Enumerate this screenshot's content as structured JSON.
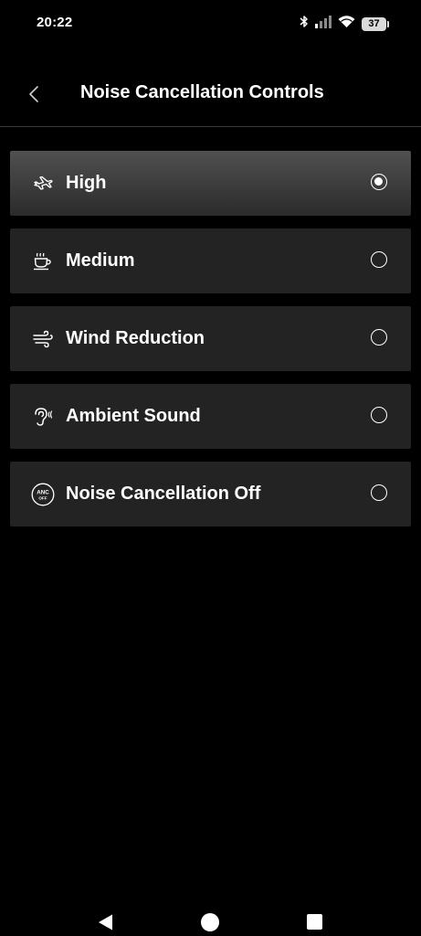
{
  "status_bar": {
    "time": "20:22",
    "battery_level": "37",
    "icons": [
      "bluetooth-icon",
      "signal-icon",
      "wifi-icon",
      "battery-icon"
    ]
  },
  "header": {
    "title": "Noise Cancellation Controls",
    "back_icon": "chevron-left-icon"
  },
  "options": [
    {
      "label": "High",
      "icon": "airplane-icon",
      "selected": true
    },
    {
      "label": "Medium",
      "icon": "coffee-cup-icon",
      "selected": false
    },
    {
      "label": "Wind Reduction",
      "icon": "wind-icon",
      "selected": false
    },
    {
      "label": "Ambient Sound",
      "icon": "ear-icon",
      "selected": false
    },
    {
      "label": "Noise Cancellation Off",
      "icon": "anc-off-icon",
      "icon_text_top": "ANC",
      "icon_text_bottom": "OFF",
      "selected": false
    }
  ],
  "colors": {
    "background": "#000000",
    "option_bg": "#232323",
    "selected_gradient_top": "#505050",
    "text": "#ffffff"
  },
  "nav_bar": {
    "icons": [
      "nav-back-icon",
      "nav-home-icon",
      "nav-recents-icon"
    ]
  }
}
